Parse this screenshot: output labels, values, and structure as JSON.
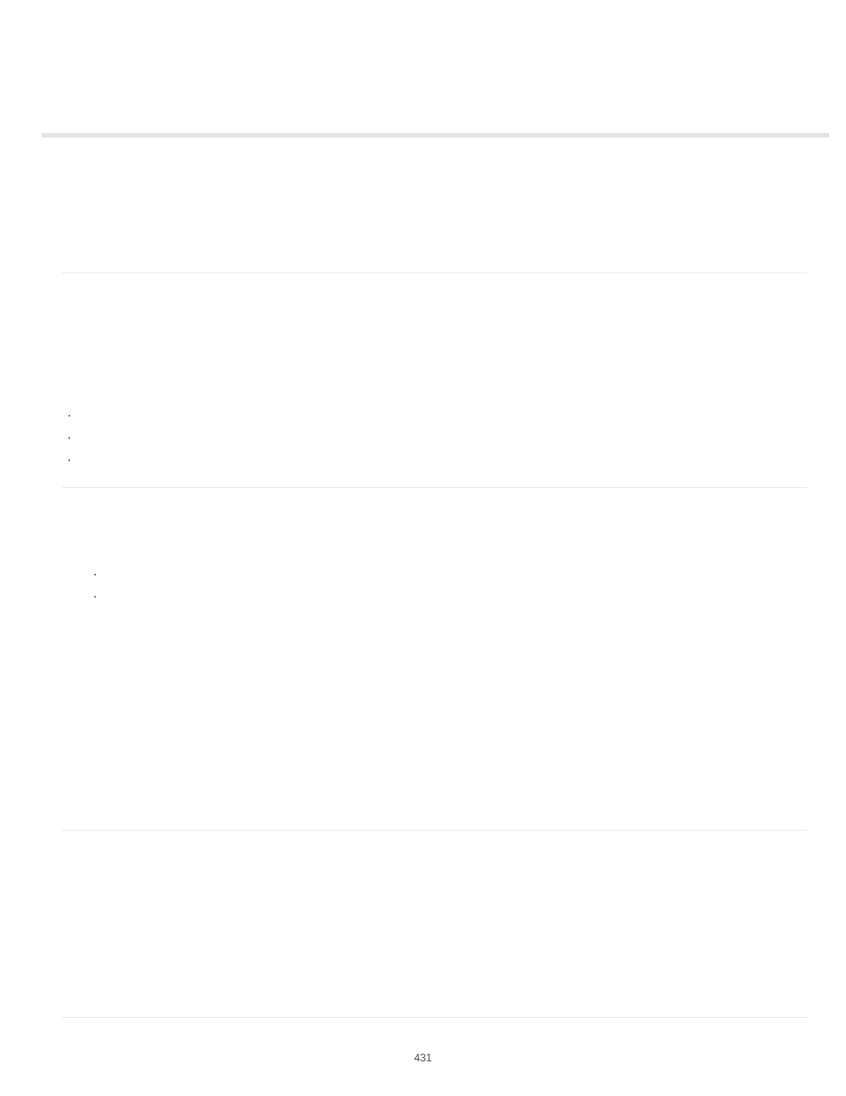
{
  "page_number": "431",
  "bullets": {
    "group1": [
      "•",
      "•",
      "•"
    ],
    "group2": [
      "•",
      "•"
    ]
  }
}
